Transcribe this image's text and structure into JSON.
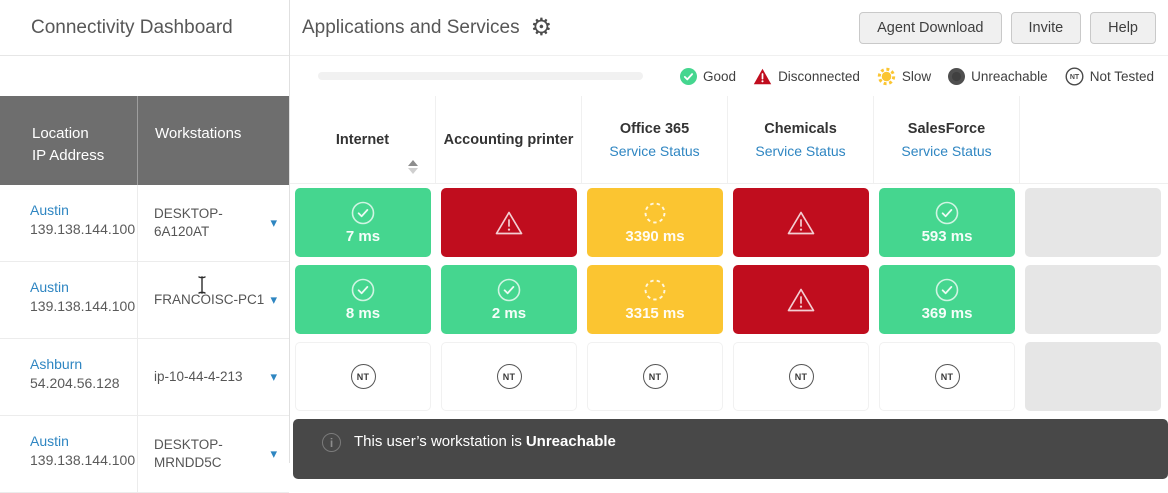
{
  "sidebar": {
    "title": "Connectivity Dashboard",
    "header": {
      "location_line1": "Location",
      "location_line2": "IP Address",
      "workstations": "Workstations"
    },
    "rows": [
      {
        "location": "Austin",
        "ip": "139.138.144.100",
        "workstation": "DESKTOP-6A120AT"
      },
      {
        "location": "Austin",
        "ip": "139.138.144.100",
        "workstation": "FRANCOISC-PC1"
      },
      {
        "location": "Ashburn",
        "ip": "54.204.56.128",
        "workstation": "ip-10-44-4-213"
      },
      {
        "location": "Austin",
        "ip": "139.138.144.100",
        "workstation": "DESKTOP-MRNDD5C"
      }
    ]
  },
  "header": {
    "title": "Applications and Services",
    "buttons": [
      {
        "label": "Agent Download"
      },
      {
        "label": "Invite"
      },
      {
        "label": "Help"
      }
    ]
  },
  "legend": [
    {
      "key": "good",
      "label": "Good"
    },
    {
      "key": "disconnected",
      "label": "Disconnected"
    },
    {
      "key": "slow",
      "label": "Slow"
    },
    {
      "key": "unreachable",
      "label": "Unreachable"
    },
    {
      "key": "not-tested",
      "label": "Not Tested"
    }
  ],
  "grid": {
    "columns": [
      {
        "label": "Internet",
        "sortable": true
      },
      {
        "label": "Accounting printer"
      },
      {
        "label": "Office 365",
        "link": "Service Status"
      },
      {
        "label": "Chemicals",
        "link": "Service Status"
      },
      {
        "label": "SalesForce",
        "link": "Service Status"
      },
      {
        "label": ""
      }
    ],
    "rows": [
      [
        {
          "status": "good",
          "value": "7 ms"
        },
        {
          "status": "disconnected"
        },
        {
          "status": "slow",
          "value": "3390 ms"
        },
        {
          "status": "disconnected"
        },
        {
          "status": "good",
          "value": "593 ms"
        },
        {
          "status": "empty"
        }
      ],
      [
        {
          "status": "good",
          "value": "8 ms"
        },
        {
          "status": "good",
          "value": "2 ms"
        },
        {
          "status": "slow",
          "value": "3315 ms"
        },
        {
          "status": "disconnected"
        },
        {
          "status": "good",
          "value": "369 ms"
        },
        {
          "status": "empty"
        }
      ],
      [
        {
          "status": "not-tested"
        },
        {
          "status": "not-tested"
        },
        {
          "status": "not-tested"
        },
        {
          "status": "not-tested"
        },
        {
          "status": "not-tested"
        },
        {
          "status": "empty"
        }
      ]
    ]
  },
  "banner": {
    "text": "This user’s workstation is",
    "emphasis": "Unreachable",
    "icon_glyph": "i"
  },
  "icons": {
    "gear": "⚙",
    "dropdown": "▾",
    "not_tested_badge": "NT"
  },
  "colors": {
    "good": "#45d68f",
    "disconnected": "#c00d1e",
    "slow": "#fbc531",
    "unreachable": "#4f4f4f",
    "empty_cell": "#e6e6e6",
    "link": "#2f86c2",
    "dark_header": "#6e6e6e",
    "banner_bg": "#484848"
  }
}
